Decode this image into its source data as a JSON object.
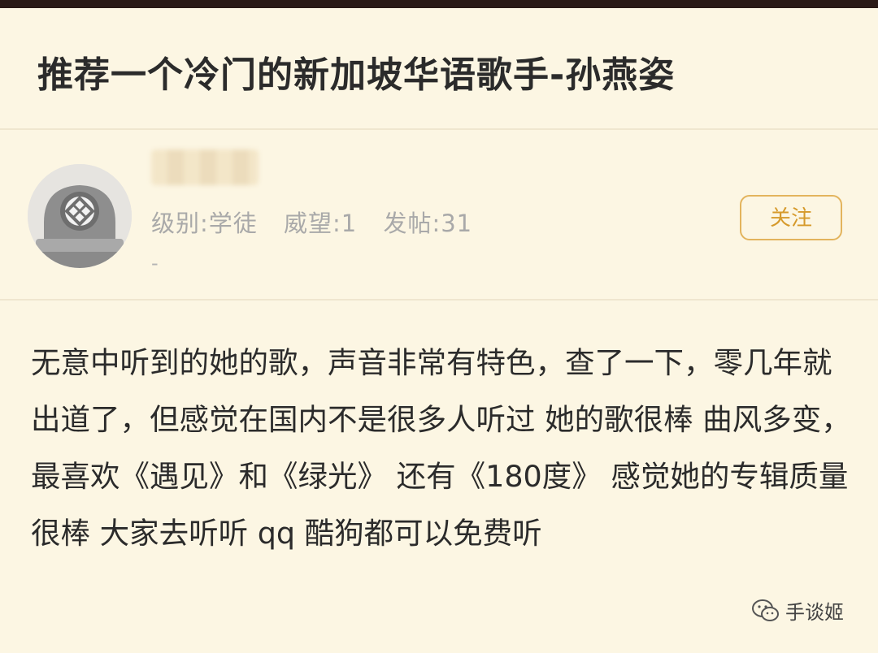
{
  "post": {
    "title": "推荐一个冷门的新加坡华语歌手-孙燕姿",
    "body": "无意中听到的她的歌，声音非常有特色，查了一下，零几年就出道了，但感觉在国内不是很多人听过 她的歌很棒 曲风多变，最喜欢《遇见》和《绿光》 还有《180度》 感觉她的专辑质量很棒 大家去听听 qq 酷狗都可以免费听"
  },
  "author": {
    "level": "级别:学徒",
    "prestige": "威望:1",
    "posts": "发帖:31",
    "extra": "-",
    "follow_label": "关注",
    "avatar_icon": "diving-helmet-icon"
  },
  "watermark": {
    "icon": "wechat-icon",
    "label": "手谈姬"
  },
  "colors": {
    "background": "#fcf6e3",
    "accent": "#e3b45d",
    "top_bar": "#2a1a16"
  }
}
